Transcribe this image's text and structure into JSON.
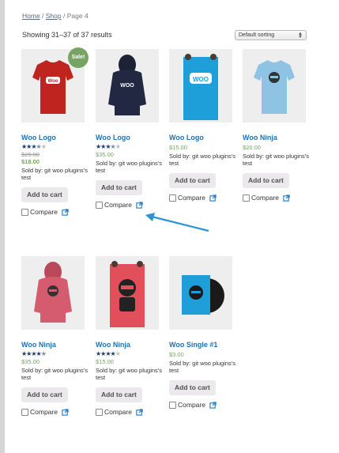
{
  "breadcrumb": {
    "home": "Home",
    "shop": "Shop",
    "current": "Page 4",
    "sep": " / "
  },
  "result_count": "Showing 31–37 of 37 results",
  "sorting": {
    "selected": "Default sorting"
  },
  "sale_badge": "Sale!",
  "compare_label": "Compare",
  "cart_label": "Add to cart",
  "colors": {
    "link": "#2271b1",
    "price": "#77a464",
    "sale": "#77a464",
    "arrow": "#2a95d6"
  },
  "products": [
    {
      "title": "Woo Logo",
      "rating": 3.5,
      "old_price": "$20.00",
      "price": "$18.00",
      "sold_by": "Sold by: git woo plugins's test",
      "on_sale": true,
      "image": "red-tshirt-woo-logo"
    },
    {
      "title": "Woo Logo",
      "rating": 3.5,
      "price": "$35.00",
      "sold_by": "Sold by: git woo plugins's test",
      "image": "navy-hoodie-woo-logo"
    },
    {
      "title": "Woo Logo",
      "price": "$15.00",
      "sold_by": "Sold by: git woo plugins's test",
      "image": "blue-poster-woo"
    },
    {
      "title": "Woo Ninja",
      "price": "$20.00",
      "sold_by": "Sold by: git woo plugins's test",
      "image": "lightblue-tshirt-ninja"
    },
    {
      "title": "Woo Ninja",
      "rating": 4.5,
      "price": "$35.00",
      "sold_by": "Sold by: git woo plugins's test",
      "image": "pink-hoodie-ninja"
    },
    {
      "title": "Woo Ninja",
      "rating": 4,
      "price": "$15.00",
      "sold_by": "Sold by: git woo plugins's test",
      "image": "red-poster-ninja"
    },
    {
      "title": "Woo Single #1",
      "price": "$3.00",
      "sold_by": "Sold by: git woo plugins's test",
      "image": "vinyl-single-album"
    }
  ]
}
